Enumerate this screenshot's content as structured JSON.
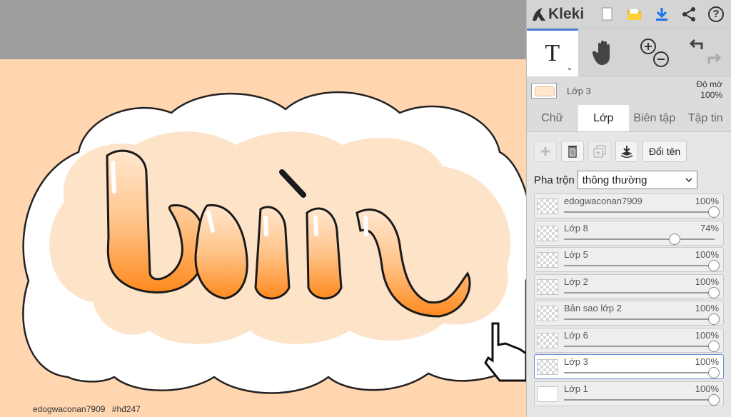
{
  "app": {
    "name": "Kleki"
  },
  "toolbar": {
    "icons": [
      "new-file-icon",
      "open-folder-icon",
      "download-icon",
      "share-icon",
      "help-icon"
    ],
    "help_glyph": "?"
  },
  "tools": {
    "text_glyph": "T",
    "caret": "⌄"
  },
  "active_layer": {
    "name": "Lớp 3",
    "opacity_label": "Độ mờ",
    "opacity_value": "100%"
  },
  "tabs": [
    {
      "label": "Chữ",
      "active": false
    },
    {
      "label": "Lớp",
      "active": true
    },
    {
      "label": "Biên tập",
      "active": false
    },
    {
      "label": "Tập tin",
      "active": false
    }
  ],
  "layer_tools": {
    "rename_label": "Đổi tên"
  },
  "blend": {
    "label": "Pha trộn",
    "value": "thông thường"
  },
  "layers": [
    {
      "name": "edogwaconan7909",
      "opacity": "100%",
      "level": 1.0,
      "thumb": "checker",
      "selected": false
    },
    {
      "name": "Lớp 8",
      "opacity": "74%",
      "level": 0.74,
      "thumb": "checker",
      "selected": false
    },
    {
      "name": "Lớp 5",
      "opacity": "100%",
      "level": 1.0,
      "thumb": "checker",
      "selected": false
    },
    {
      "name": "Lớp 2",
      "opacity": "100%",
      "level": 1.0,
      "thumb": "checker",
      "selected": false
    },
    {
      "name": "Bản sao lớp 2",
      "opacity": "100%",
      "level": 1.0,
      "thumb": "checker",
      "selected": false
    },
    {
      "name": "Lớp 6",
      "opacity": "100%",
      "level": 1.0,
      "thumb": "checker",
      "selected": false
    },
    {
      "name": "Lớp 3",
      "opacity": "100%",
      "level": 1.0,
      "thumb": "checker",
      "selected": true
    },
    {
      "name": "Lớp 1",
      "opacity": "100%",
      "level": 1.0,
      "thumb": "white",
      "selected": false
    }
  ],
  "canvas": {
    "watermark_user": "edogwaconan7909",
    "watermark_tag": "#hđ247",
    "colors": {
      "background": "#ffd6b0",
      "cloud": "#ffffff",
      "accent": "#ff9a3c"
    }
  },
  "colors": {
    "accent_blue": "#4a7fd6",
    "download_blue": "#1a73e8",
    "folder_yellow": "#f2b705"
  }
}
